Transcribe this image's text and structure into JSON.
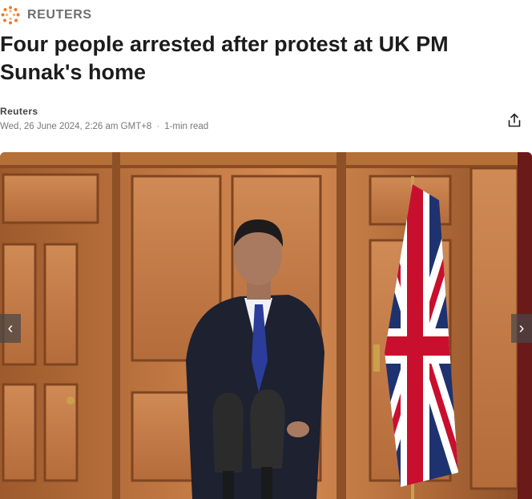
{
  "publisher": {
    "name": "REUTERS",
    "logo_icon": "reuters-logo-icon"
  },
  "article": {
    "title": "Four people arrested after protest at UK PM Sunak's home",
    "author": "Reuters",
    "date": "Wed, 26 June 2024, 2:26 am GMT+8",
    "separator": "·",
    "read_time": "1-min read"
  },
  "actions": {
    "share_icon": "share-icon"
  },
  "gallery": {
    "prev_icon": "chevron-left-icon",
    "next_icon": "chevron-right-icon",
    "prev_glyph": "‹",
    "next_glyph": "›"
  },
  "colors": {
    "publisher_text": "#6f6f6f",
    "headline": "#1c1c1c",
    "panelling": "#b86e3c"
  }
}
